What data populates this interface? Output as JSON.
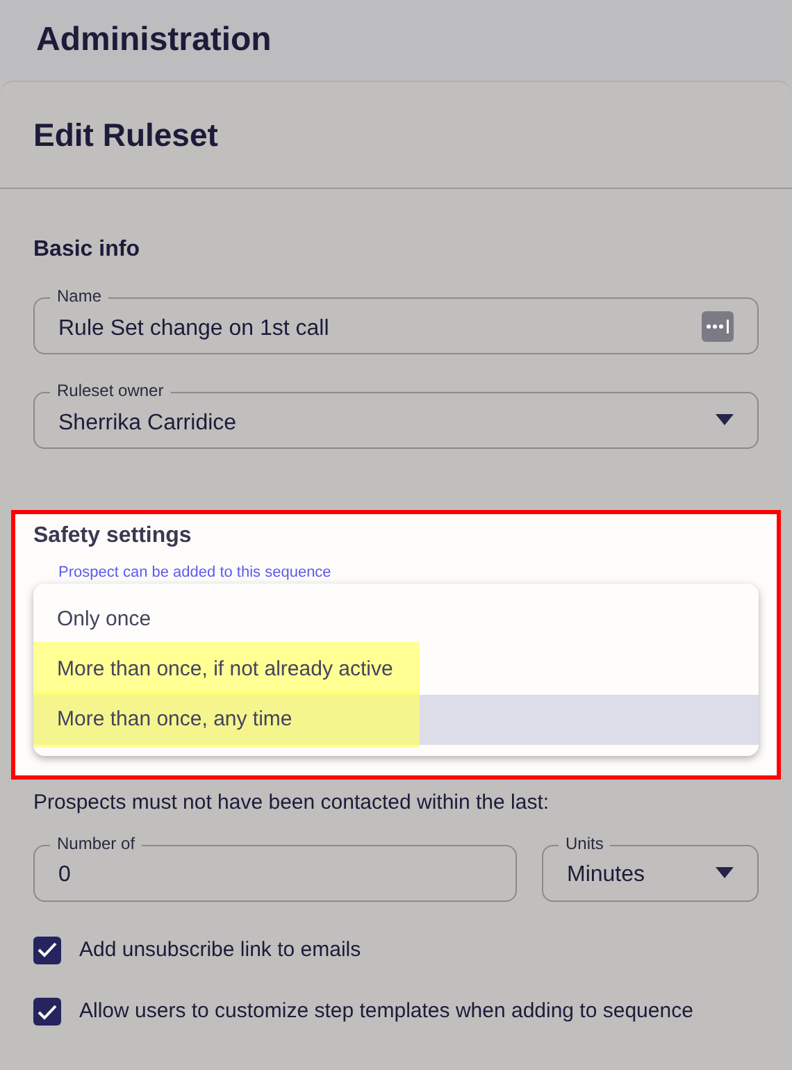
{
  "page_title": "Administration",
  "card_title": "Edit Ruleset",
  "basic_info": {
    "heading": "Basic info",
    "fields": [
      {
        "kind": "text",
        "label": "Name",
        "value": "Rule Set change on 1st call"
      },
      {
        "kind": "select",
        "label": "Ruleset owner",
        "value": "Sherrika Carridice"
      }
    ]
  },
  "safety_settings": {
    "heading": "Safety settings",
    "dropdown_label": "Prospect can be added to this sequence",
    "options": [
      {
        "label": "Only once",
        "selected": false,
        "highlighted": false
      },
      {
        "label": "More than once, if not already active",
        "selected": false,
        "highlighted": true
      },
      {
        "label": "More than once, any time",
        "selected": true,
        "highlighted": true
      }
    ]
  },
  "contact_rule": {
    "text": "Prospects must not have been contacted within the last:",
    "fields": [
      {
        "kind": "text",
        "label": "Number of",
        "value": "0"
      },
      {
        "kind": "select",
        "label": "Units",
        "value": "Minutes"
      }
    ]
  },
  "checkboxes": [
    {
      "label": "Add unsubscribe link to emails",
      "checked": true
    },
    {
      "label": "Allow users to customize step templates when adding to sequence",
      "checked": true
    }
  ]
}
